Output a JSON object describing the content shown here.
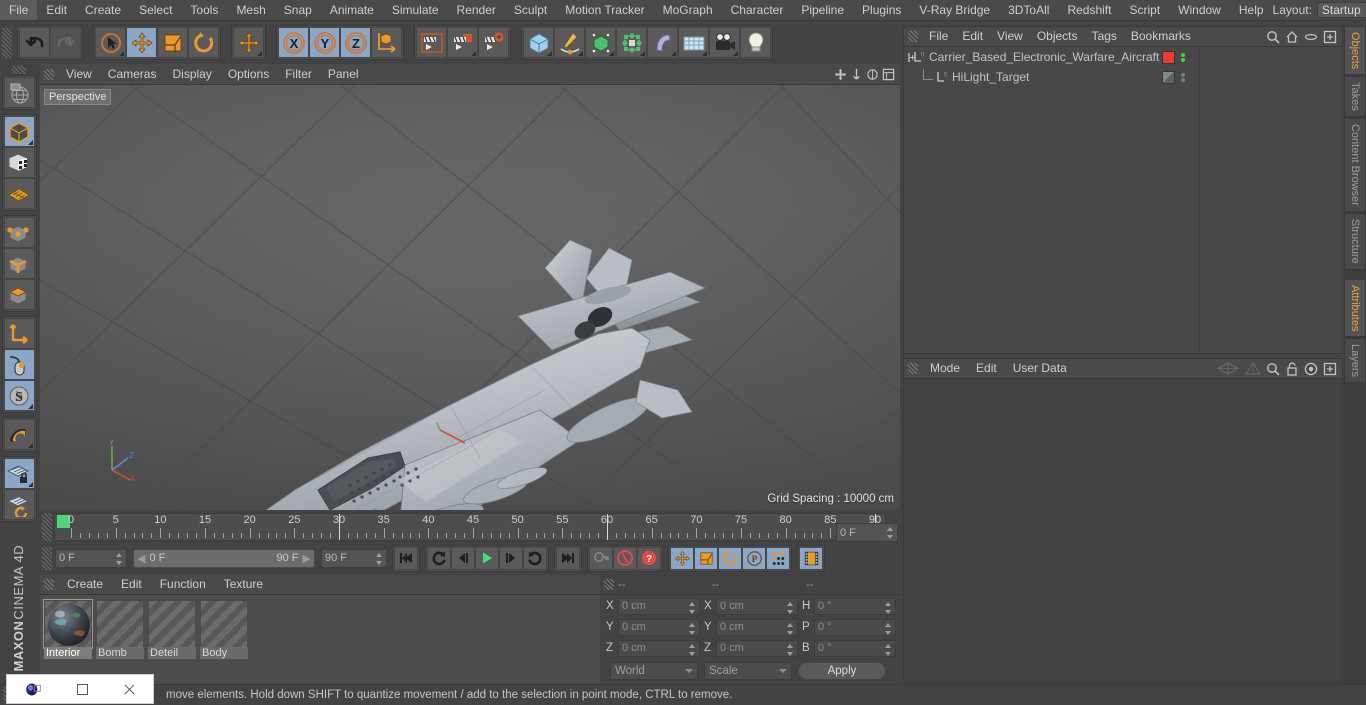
{
  "app": {
    "brand_line1": "MAXON",
    "brand_line2": "CINEMA 4D"
  },
  "menubar": {
    "items": [
      {
        "label": "File"
      },
      {
        "label": "Edit"
      },
      {
        "label": "Create"
      },
      {
        "label": "Select"
      },
      {
        "label": "Tools"
      },
      {
        "label": "Mesh"
      },
      {
        "label": "Snap"
      },
      {
        "label": "Animate"
      },
      {
        "label": "Simulate"
      },
      {
        "label": "Render"
      },
      {
        "label": "Sculpt"
      },
      {
        "label": "Motion Tracker"
      },
      {
        "label": "MoGraph"
      },
      {
        "label": "Character"
      },
      {
        "label": "Pipeline"
      },
      {
        "label": "Plugins"
      },
      {
        "label": "V-Ray Bridge"
      },
      {
        "label": "3DToAll"
      },
      {
        "label": "Redshift"
      },
      {
        "label": "Script"
      },
      {
        "label": "Window"
      },
      {
        "label": "Help"
      }
    ],
    "layout_label": "Layout:",
    "layout_value": "Startup",
    "search_icon": "search-icon"
  },
  "toolbar": {
    "groups": [
      {
        "buttons": [
          {
            "name": "undo-button",
            "icon": "undo-arrow",
            "state": "normal"
          },
          {
            "name": "redo-button",
            "icon": "redo-arrow",
            "state": "disabled"
          }
        ]
      },
      {
        "buttons": [
          {
            "name": "live-selection-tool",
            "icon": "cursor-circle",
            "state": "normal"
          },
          {
            "name": "move-tool",
            "icon": "move-cross",
            "state": "selected"
          },
          {
            "name": "scale-tool",
            "icon": "scale-box",
            "state": "normal"
          },
          {
            "name": "rotate-tool",
            "icon": "rotate-arc",
            "state": "normal"
          }
        ]
      },
      {
        "buttons": [
          {
            "name": "last-tool",
            "icon": "move-cross",
            "state": "normal"
          }
        ]
      },
      {
        "buttons": [
          {
            "name": "lock-x-axis",
            "icon": "x-axis",
            "state": "selected"
          },
          {
            "name": "lock-y-axis",
            "icon": "y-axis",
            "state": "selected"
          },
          {
            "name": "lock-z-axis",
            "icon": "z-axis",
            "state": "selected"
          },
          {
            "name": "world-object-coordinates",
            "icon": "world-axis-cube",
            "state": "normal"
          }
        ]
      },
      {
        "buttons": [
          {
            "name": "render-view",
            "icon": "clapper-view",
            "state": "normal"
          },
          {
            "name": "render-to-picture-viewer",
            "icon": "clapper-picture",
            "state": "normal"
          },
          {
            "name": "render-settings",
            "icon": "clapper-gear",
            "state": "normal"
          }
        ]
      },
      {
        "buttons": [
          {
            "name": "add-cube-object",
            "icon": "blue-cube",
            "state": "normal"
          },
          {
            "name": "add-spline",
            "icon": "pen-spline",
            "state": "normal"
          },
          {
            "name": "add-generator",
            "icon": "green-cube",
            "state": "normal"
          },
          {
            "name": "add-mograph-cloner",
            "icon": "green-cluster",
            "state": "normal"
          },
          {
            "name": "add-deformer",
            "icon": "bend-shape",
            "state": "normal"
          },
          {
            "name": "add-environment",
            "icon": "floor-grid",
            "state": "normal"
          },
          {
            "name": "add-camera",
            "icon": "camera",
            "state": "normal"
          },
          {
            "name": "add-light",
            "icon": "lightbulb",
            "state": "normal"
          }
        ]
      }
    ]
  },
  "left_toolbar": {
    "groups": [
      {
        "buttons": [
          {
            "name": "make-editable",
            "icon": "globe-wire",
            "state": "normal"
          }
        ]
      },
      {
        "buttons": [
          {
            "name": "model-mode",
            "icon": "dark-cube",
            "state": "selected"
          },
          {
            "name": "texture-mode",
            "icon": "checker-cube",
            "state": "normal"
          },
          {
            "name": "uv-mode",
            "icon": "orange-grid",
            "state": "normal"
          }
        ]
      },
      {
        "buttons": [
          {
            "name": "points-mode",
            "icon": "cube-points",
            "state": "normal"
          },
          {
            "name": "edges-mode",
            "icon": "cube-edges",
            "state": "normal"
          },
          {
            "name": "polygons-mode",
            "icon": "cube-polygon",
            "state": "normal"
          }
        ]
      },
      {
        "buttons": [
          {
            "name": "object-axis-mode",
            "icon": "orange-axis",
            "state": "normal"
          },
          {
            "name": "enable-snapping",
            "icon": "mouse-snap",
            "state": "selected"
          },
          {
            "name": "workplane-mode",
            "icon": "s-compass",
            "state": "selected"
          }
        ]
      },
      {
        "buttons": [
          {
            "name": "magnet-tool",
            "icon": "magnet",
            "state": "normal"
          }
        ]
      },
      {
        "buttons": [
          {
            "name": "lock-workplane",
            "icon": "grid-lock",
            "state": "selected"
          },
          {
            "name": "planar-workplane",
            "icon": "grid-rotate",
            "state": "normal"
          }
        ]
      }
    ]
  },
  "viewport": {
    "menu": [
      {
        "label": "View"
      },
      {
        "label": "Cameras"
      },
      {
        "label": "Display"
      },
      {
        "label": "Options"
      },
      {
        "label": "Filter"
      },
      {
        "label": "Panel"
      }
    ],
    "view_label": "Perspective",
    "grid_spacing": "Grid Spacing : 10000 cm",
    "axis_labels": {
      "x": "X",
      "y": "Y",
      "z": "Z"
    },
    "icons": [
      "pan-icon",
      "zoom-icon",
      "rotate-icon",
      "maximize-icon"
    ]
  },
  "timeline": {
    "ticks": [
      0,
      5,
      10,
      15,
      20,
      25,
      30,
      35,
      40,
      45,
      50,
      55,
      60,
      65,
      70,
      75,
      80,
      85,
      90
    ],
    "current_frame_right": "0 F",
    "current_frame": "0 F",
    "range_start": "0 F",
    "range_end": "90 F",
    "end_frame": "90 F",
    "transport": [
      {
        "name": "go-to-start-button",
        "icon": "skip-start"
      },
      {
        "name": "go-to-previous-key-button",
        "icon": "prev-key"
      },
      {
        "name": "step-back-button",
        "icon": "step-back"
      },
      {
        "name": "play-button",
        "icon": "play"
      },
      {
        "name": "step-forward-button",
        "icon": "step-forward"
      },
      {
        "name": "go-to-next-key-button",
        "icon": "next-key"
      },
      {
        "name": "go-to-end-button",
        "icon": "skip-end"
      }
    ],
    "record_tools": [
      {
        "name": "autokeying-button",
        "icon": "key"
      },
      {
        "name": "record-active-objects-button",
        "icon": "record-red"
      },
      {
        "name": "animation-help-button",
        "icon": "question-red"
      }
    ],
    "key_tools": [
      {
        "name": "key-position-button",
        "icon": "move-cross"
      },
      {
        "name": "key-scale-button",
        "icon": "scale-box"
      },
      {
        "name": "key-rotation-button",
        "icon": "rotate-arc"
      },
      {
        "name": "key-parameter-button",
        "icon": "p-circle"
      },
      {
        "name": "key-point-level-button",
        "icon": "dots-grid"
      }
    ],
    "extra_tools": [
      {
        "name": "timeline-toggle-button",
        "icon": "filmstrip"
      }
    ]
  },
  "material_manager": {
    "menu": [
      {
        "label": "Create"
      },
      {
        "label": "Edit"
      },
      {
        "label": "Function"
      },
      {
        "label": "Texture"
      }
    ],
    "materials": [
      {
        "name": "Interior",
        "active": true,
        "preview": "sphere"
      },
      {
        "name": "Bomb",
        "active": false,
        "preview": "none"
      },
      {
        "name": "Deteil",
        "active": false,
        "preview": "none"
      },
      {
        "name": "Body",
        "active": false,
        "preview": "none"
      }
    ]
  },
  "coordinates": {
    "headers": [
      "--",
      "--",
      "--"
    ],
    "rows": [
      {
        "label1": "X",
        "value1": "0 cm",
        "label2": "X",
        "value2": "0 cm",
        "label3": "H",
        "value3": "0 °"
      },
      {
        "label1": "Y",
        "value1": "0 cm",
        "label2": "Y",
        "value2": "0 cm",
        "label3": "P",
        "value3": "0 °"
      },
      {
        "label1": "Z",
        "value1": "0 cm",
        "label2": "Z",
        "value2": "0 cm",
        "label3": "B",
        "value3": "0 °"
      }
    ],
    "system_select": "World",
    "mode_select": "Scale",
    "apply_label": "Apply"
  },
  "object_manager": {
    "menu": [
      {
        "label": "File"
      },
      {
        "label": "Edit"
      },
      {
        "label": "View"
      },
      {
        "label": "Objects"
      },
      {
        "label": "Tags"
      },
      {
        "label": "Bookmarks"
      }
    ],
    "icons": [
      "search-icon",
      "home-icon",
      "ellipse-icon",
      "plus-box-icon"
    ],
    "rows": [
      {
        "label": "Carrier_Based_Electronic_Warfare_Aircraft",
        "selected": false,
        "expandable": true,
        "icon": "null-object-icon",
        "tag_color": "#ef3a33",
        "dot_state": "active",
        "depth": 0
      },
      {
        "label": "HiLight_Target",
        "selected": false,
        "expandable": false,
        "icon": "null-object-icon",
        "tag_color": "#6e6e6e",
        "dot_state": "dim",
        "depth": 1
      }
    ]
  },
  "attributes": {
    "menu": [
      {
        "label": "Mode"
      },
      {
        "label": "Edit"
      },
      {
        "label": "User Data"
      }
    ],
    "icons": [
      "back-nav-icon",
      "forward-nav-icon",
      "search-icon",
      "lock-icon",
      "target-icon",
      "plus-box-icon"
    ]
  },
  "right_tabs": {
    "top": [
      {
        "label": "Objects",
        "active": true
      },
      {
        "label": "Takes",
        "active": false
      },
      {
        "label": "Content Browser",
        "active": false
      },
      {
        "label": "Structure",
        "active": false
      }
    ],
    "bottom": [
      {
        "label": "Attributes",
        "active": true
      },
      {
        "label": "Layers",
        "active": false
      }
    ]
  },
  "status_bar": {
    "text": "move elements. Hold down SHIFT to quantize movement / add to the selection in point mode, CTRL to remove."
  },
  "taskbar_popup": {
    "icons": [
      "cinema4d-app-icon",
      "restore-window-icon",
      "close-window-icon"
    ]
  },
  "colors": {
    "accent_orange": "#e8a33d",
    "selection_blue": "#8aa7c8",
    "panel_bg": "#434343",
    "header_bg": "#4a4a4a",
    "tag_red": "#ef3a33",
    "play_green": "#4fd67a"
  }
}
